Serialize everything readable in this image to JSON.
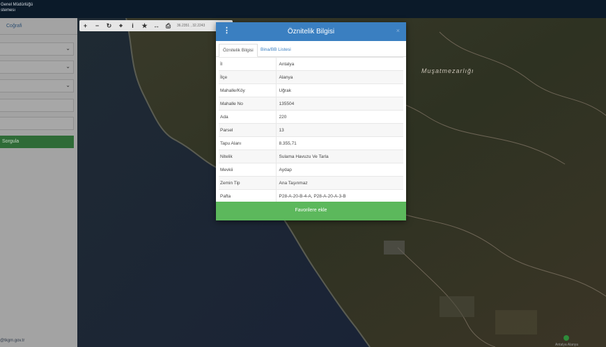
{
  "topbar": {
    "line1": "Genel Müdürlüğü",
    "line2": "stemesı"
  },
  "sidebar": {
    "tab_label": "Coğrafi",
    "query_button": "Sorgula",
    "footer_email": "@tkgm.gov.tr"
  },
  "map": {
    "place_label": "Muşatmezarlığı",
    "footer_text": "Antalya Alanya"
  },
  "toolbar": {
    "buttons": [
      {
        "name": "zoom-in-icon",
        "glyph": "+"
      },
      {
        "name": "zoom-out-icon",
        "glyph": "−"
      },
      {
        "name": "refresh-icon",
        "glyph": "↻"
      },
      {
        "name": "locate-icon",
        "glyph": "⌖"
      },
      {
        "name": "info-icon",
        "glyph": "i"
      },
      {
        "name": "star-icon",
        "glyph": "★"
      },
      {
        "name": "measure-icon",
        "glyph": "↔"
      },
      {
        "name": "print-icon",
        "glyph": "⎙"
      }
    ],
    "coords": "36.2351 , 32.2243"
  },
  "modal": {
    "title": "Öznitelik Bilgisi",
    "close": "×",
    "tabs": {
      "active": "Öznitelik Bilgisi",
      "inactive": "Bina/BB Listesi"
    },
    "rows": [
      {
        "key": "İl",
        "value": "Antalya"
      },
      {
        "key": "İlçe",
        "value": "Alanya"
      },
      {
        "key": "Mahalle/Köy",
        "value": "Uğrak"
      },
      {
        "key": "Mahalle No",
        "value": "135504"
      },
      {
        "key": "Ada",
        "value": "220"
      },
      {
        "key": "Parsel",
        "value": "13"
      },
      {
        "key": "Tapu Alanı",
        "value": "8.355,71"
      },
      {
        "key": "Nitelik",
        "value": "Sulama Havuzu Ve Tarla"
      },
      {
        "key": "Mevkii",
        "value": "Aydap"
      },
      {
        "key": "Zemin Tip",
        "value": "Ana Taşınmaz"
      },
      {
        "key": "Pafta",
        "value": "P28-A-20-B-4-A, P28-A-20-A-3-B"
      }
    ],
    "favorite_button": "Favorilere ekle"
  },
  "colors": {
    "header_blue": "#3a7fc1",
    "favorite_green": "#5cb85c",
    "topbar_navy": "#0b1a29"
  }
}
